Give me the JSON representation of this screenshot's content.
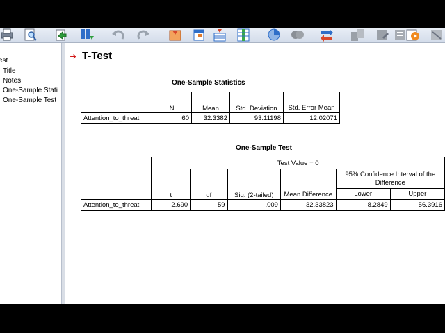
{
  "nav": {
    "items": [
      "est",
      "Title",
      "Notes",
      "One-Sample Stati",
      "One-Sample Test"
    ]
  },
  "output": {
    "heading": "T-Test",
    "stats": {
      "title": "One-Sample Statistics",
      "headers": [
        "N",
        "Mean",
        "Std. Deviation",
        "Std. Error Mean"
      ],
      "row": {
        "label": "Attention_to_threat",
        "values": [
          "60",
          "32.3382",
          "93.11198",
          "12.02071"
        ]
      }
    },
    "test": {
      "title": "One-Sample Test",
      "test_value": "Test Value = 0",
      "headers": [
        "t",
        "df",
        "Sig. (2-tailed)",
        "Mean Difference"
      ],
      "ci_header": "95% Confidence Interval of the Difference",
      "ci_sub": [
        "Lower",
        "Upper"
      ],
      "row": {
        "label": "Attention_to_threat",
        "values": [
          "2.690",
          "59",
          ".009",
          "32.33823",
          "8.2849",
          "56.3916"
        ]
      }
    }
  },
  "toolbar": {
    "icons": [
      "print-icon",
      "find-icon",
      "export-icon",
      "goto-data-icon",
      "undo-icon",
      "redo-icon",
      "variables-icon",
      "goto-case-icon",
      "insert-cases-icon",
      "insert-variable-icon",
      "pivot-icon",
      "select-cases-icon",
      "weight-cases-icon",
      "split-file-icon",
      "value-labels-icon",
      "output-icon",
      "designate-window-icon",
      "script-icon",
      "dialog-recall-icon"
    ]
  },
  "colors": {
    "accent_arrow": "#d21a1a",
    "splitter": "#d9dee6"
  }
}
